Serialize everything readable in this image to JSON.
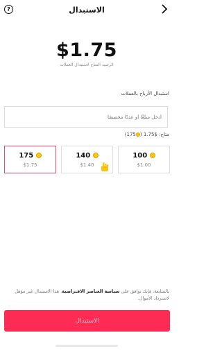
{
  "header": {
    "title": "الاستبدال",
    "back_icon": "chevron-right-icon",
    "help_icon": "help-circle-icon",
    "help_glyph": "?"
  },
  "balance": {
    "amount": "$1.75",
    "caption": "الرصيد المتاح لاستبدال العملات"
  },
  "redeem": {
    "section_label": "استبدال الأرباح بالعملات",
    "input_placeholder": "أدخل مبلغًا أو عددًا مخصصًا",
    "available_prefix": "متاح: $1.75 (",
    "available_coins": "175",
    "available_suffix": ")"
  },
  "packages": [
    {
      "coins": "100",
      "price": "$1.00",
      "selected": false
    },
    {
      "coins": "140",
      "price": "$1.40",
      "selected": false
    },
    {
      "coins": "175",
      "price": "$1.75",
      "selected": true
    }
  ],
  "footer": {
    "note_prefix": "بالمتابعة، فإنك توافق على",
    "policy_link": "سياسة العناصر الافتراضية",
    "note_suffix": ". هذا الاستبدال غير مؤهل لاسترداد الأموال.",
    "button_label": "الاستبدال"
  },
  "colors": {
    "accent": "#fe2c55",
    "selected_border": "#e6496a",
    "coin": "#f4c518"
  }
}
